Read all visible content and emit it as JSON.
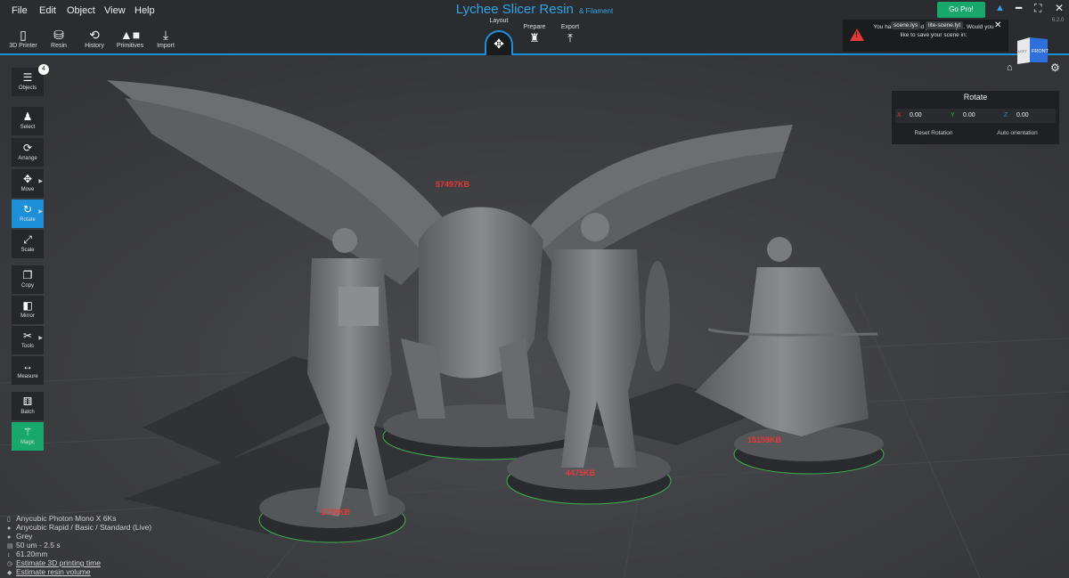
{
  "menu": {
    "file": "File",
    "edit": "Edit",
    "object": "Object",
    "view": "View",
    "help": "Help"
  },
  "app": {
    "title": "Lychee Slicer Resin",
    "subtitle": "& Filament",
    "version": "6.2.0"
  },
  "toolbar": {
    "printer": "3D Printer",
    "resin": "Resin",
    "history": "History",
    "primitives": "Primitives",
    "import": "Import"
  },
  "workflow": {
    "layout": "Layout",
    "prepare": "Prepare",
    "export": "Export"
  },
  "go_pro": "Go Pro!",
  "notification": {
    "message": "You have not saved your scene yet. Would you like to save your scene in:",
    "option1": "scene.lys",
    "option2": "lite-scene.lyt"
  },
  "view_cube": {
    "front": "FRONT",
    "left": "LEFT"
  },
  "left_tools": {
    "objects": "Objects",
    "objects_count": "4",
    "select": "Select",
    "arrange": "Arrange",
    "move": "Move",
    "rotate": "Rotate",
    "scale": "Scale",
    "copy": "Copy",
    "mirror": "Mirror",
    "tools": "Tools",
    "measure": "Measure",
    "batch": "Batch",
    "magic": "Magic"
  },
  "rotate_panel": {
    "title": "Rotate",
    "x_label": "X",
    "x_value": "0.00",
    "y_label": "Y",
    "y_value": "0.00",
    "z_label": "Z",
    "z_value": "0.00",
    "reset": "Reset Rotation",
    "auto": "Auto orientation"
  },
  "models": {
    "lion_size": "57497KB",
    "girl_size": "1720KB",
    "warrior_size": "4475KB",
    "archer_size": "15159KB"
  },
  "status": {
    "printer": "Anycubic Photon Mono X 6Ks",
    "profile": "Anycubic Rapid / Basic / Standard (Live)",
    "color": "Grey",
    "layer": "50 um - 2.5 s",
    "height": "61.20mm",
    "estimate_time": "Estimate 3D printing time",
    "estimate_volume": "Estimate resin volume"
  },
  "colors": {
    "accent": "#1d8fd8",
    "go_pro": "#18a86b",
    "label_red": "#e53935",
    "build_plate": "#3a3b3e"
  }
}
